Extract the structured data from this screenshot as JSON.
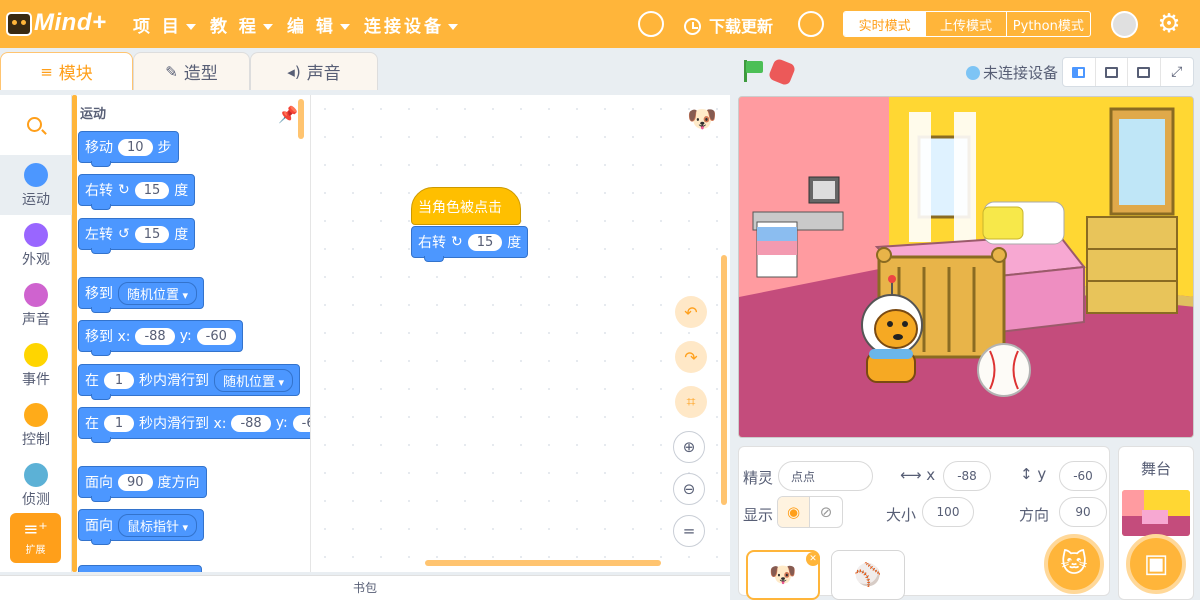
{
  "app": {
    "name": "Mind+"
  },
  "menu": [
    "项 目",
    "教 程",
    "编 辑",
    "连接设备"
  ],
  "header": {
    "download_label": "下载更新",
    "modes": [
      "实时模式",
      "上传模式",
      "Python模式"
    ],
    "active_mode": "实时模式"
  },
  "tabs": [
    {
      "label": "模块",
      "icon": "blocks-icon"
    },
    {
      "label": "造型",
      "icon": "brush-icon"
    },
    {
      "label": "声音",
      "icon": "speaker-icon"
    }
  ],
  "categories": [
    {
      "label": "运动",
      "color": "#4c97ff"
    },
    {
      "label": "外观",
      "color": "#9966ff"
    },
    {
      "label": "声音",
      "color": "#cf63cf"
    },
    {
      "label": "事件",
      "color": "#ffd500"
    },
    {
      "label": "控制",
      "color": "#ffab19"
    },
    {
      "label": "侦测",
      "color": "#5cb1d6"
    }
  ],
  "extension_label": "扩展",
  "palette": {
    "title": "运动",
    "blocks": [
      {
        "parts": [
          "移动",
          "10",
          "步"
        ]
      },
      {
        "parts": [
          "右转",
          "↻",
          "15",
          "度"
        ]
      },
      {
        "parts": [
          "左转",
          "↺",
          "15",
          "度"
        ]
      },
      {
        "parts": [
          "移到",
          "随机位置"
        ]
      },
      {
        "parts": [
          "移到 x:",
          "-88",
          "y:",
          "-60"
        ]
      },
      {
        "parts": [
          "在",
          "1",
          "秒内滑行到",
          "随机位置"
        ]
      },
      {
        "parts": [
          "在",
          "1",
          "秒内滑行到 x:",
          "-88",
          "y:",
          "-6"
        ]
      },
      {
        "parts": [
          "面向",
          "90",
          "度方向"
        ]
      },
      {
        "parts": [
          "面向",
          "鼠标指针"
        ]
      }
    ]
  },
  "workspace": {
    "hat_label": "当角色被点击",
    "turn_block": {
      "label": "右转",
      "value": "15",
      "unit": "度"
    }
  },
  "backpack_label": "书包",
  "stage_header": {
    "connection_status": "未连接设备"
  },
  "sprite_info": {
    "sprite_label": "精灵",
    "sprite_name_placeholder": "点点",
    "x_label": "x",
    "x_value": "-88",
    "y_label": "y",
    "y_value": "-60",
    "show_label": "显示",
    "size_label": "大小",
    "size_value": "100",
    "direction_label": "方向",
    "direction_value": "90"
  },
  "stage_panel": {
    "title": "舞台"
  },
  "colors": {
    "brand": "#ffb53a",
    "accent": "#ff9f1a",
    "motion": "#4c97ff",
    "events": "#ffbf00"
  }
}
